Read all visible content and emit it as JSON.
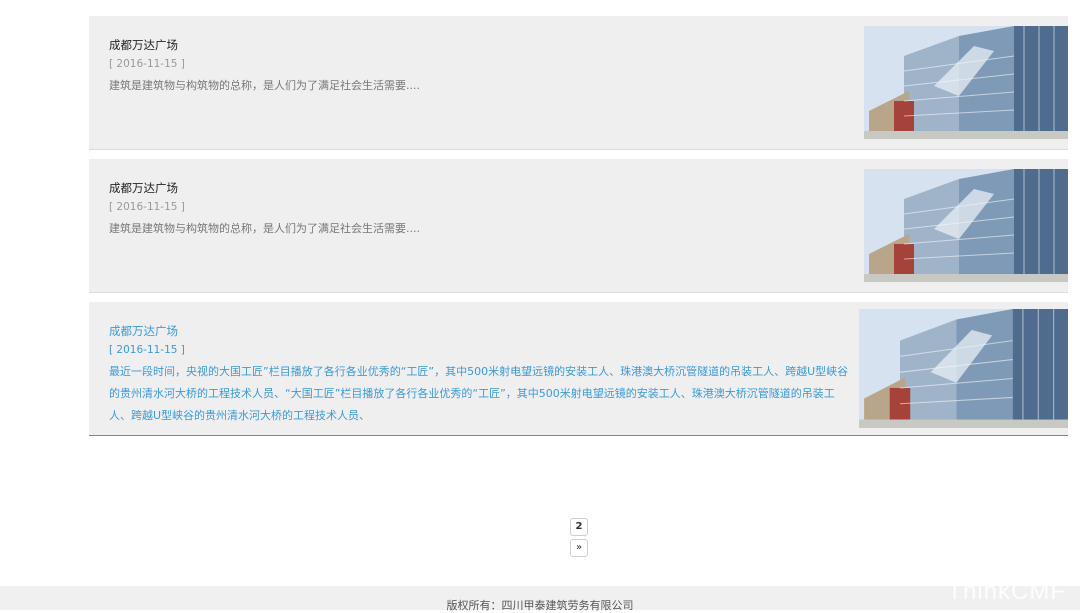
{
  "news": [
    {
      "title": "成都万达广场",
      "date": "[ 2016-11-15 ]",
      "summary": "建筑是建筑物与构筑物的总称，是人们为了满足社会生活需要....",
      "image": "building-photo"
    },
    {
      "title": "成都万达广场",
      "date": "[ 2016-11-15 ]",
      "summary": "建筑是建筑物与构筑物的总称，是人们为了满足社会生活需要....",
      "image": "building-photo"
    },
    {
      "title": "成都万达广场",
      "date": "[ 2016-11-15 ]",
      "summary": "最近一段时间，央视的大国工匠”栏目播放了各行各业优秀的“工匠”，其中500米射电望远镜的安装工人、珠港澳大桥沉管隧道的吊装工人、跨越U型峡谷的贵州清水河大桥的工程技术人员、“大国工匠”栏目播放了各行各业优秀的“工匠”，其中500米射电望远镜的安装工人、珠港澳大桥沉管隧道的吊装工人、跨越U型峡谷的贵州清水河大桥的工程技术人员、",
      "image": "building-photo"
    }
  ],
  "pagination": {
    "current": "2",
    "next": "»"
  },
  "footer": {
    "copyright": "版权所有：四川甲泰建筑劳务有限公司",
    "watermark": "ThinkCMF"
  },
  "colors": {
    "accent": "#3a9ad9",
    "card_bg": "#efefef"
  }
}
